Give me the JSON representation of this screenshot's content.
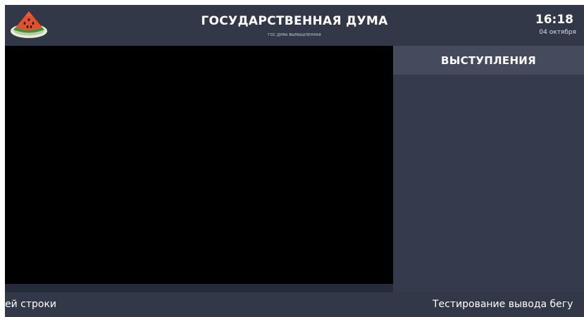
{
  "header": {
    "title": "ГОСУДАРСТВЕННАЯ ДУМА",
    "subtitle": "ГОС.ДУМА ВЫМЫШЛЕННАЯ",
    "logo_icon": "watermelon-slice-icon"
  },
  "clock": {
    "time": "16:18",
    "date": "04 октября"
  },
  "side_panel": {
    "title": "ВЫСТУПЛЕНИЯ"
  },
  "ticker": {
    "left_text": "ей строки",
    "right_text": "Тестирование вывода бегу"
  },
  "colors": {
    "background": "#333849",
    "side_header": "#454b5d",
    "video": "#000000"
  }
}
